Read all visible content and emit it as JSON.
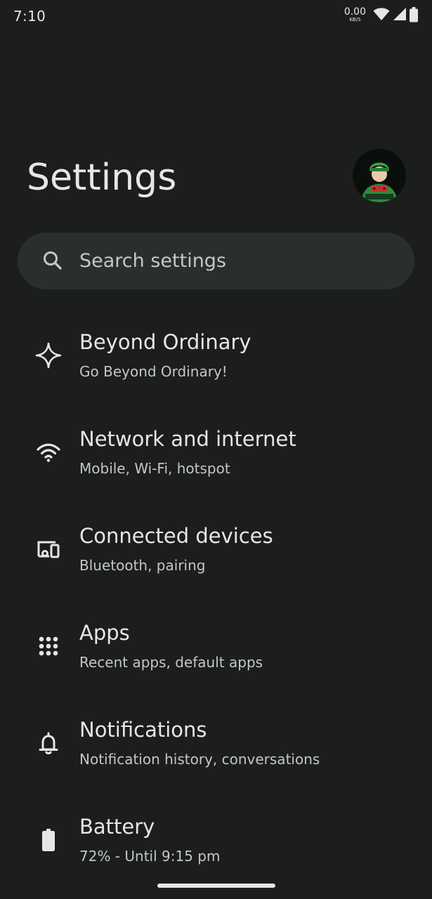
{
  "status_bar": {
    "time": "7:10",
    "net_speed_value": "0.00",
    "net_speed_unit": "KB/S",
    "icons": [
      "wifi-icon",
      "cell-signal-icon",
      "battery-icon"
    ]
  },
  "header": {
    "title": "Settings",
    "avatar": "profile-avatar"
  },
  "search": {
    "placeholder": "Search settings",
    "icon": "search-icon"
  },
  "items": [
    {
      "title": "Beyond Ordinary",
      "subtitle": "Go Beyond Ordinary!",
      "icon": "sparkle-icon"
    },
    {
      "title": "Network and internet",
      "subtitle": "Mobile, Wi-Fi, hotspot",
      "icon": "wifi-icon"
    },
    {
      "title": "Connected devices",
      "subtitle": "Bluetooth, pairing",
      "icon": "devices-icon"
    },
    {
      "title": "Apps",
      "subtitle": "Recent apps, default apps",
      "icon": "apps-grid-icon"
    },
    {
      "title": "Notifications",
      "subtitle": "Notification history, conversations",
      "icon": "bell-icon"
    },
    {
      "title": "Battery",
      "subtitle": "72% - Until 9:15 pm",
      "icon": "battery-icon"
    }
  ],
  "colors": {
    "background": "#1b1e1c",
    "search_bg": "#2b2f2c",
    "text_primary": "#e6e7e4",
    "text_secondary": "#c4c7c3"
  }
}
